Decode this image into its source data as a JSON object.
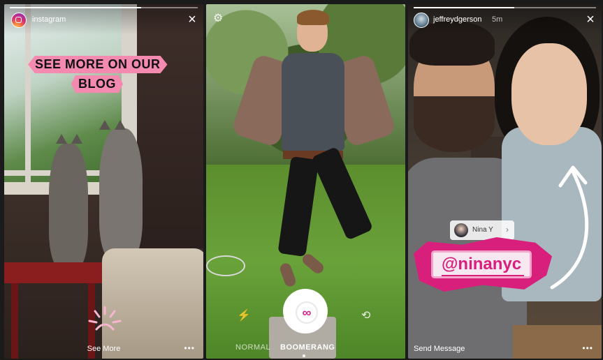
{
  "stories": [
    {
      "username": "instagram",
      "banner_line1": "SEE MORE ON OUR",
      "banner_line2": "BLOG",
      "cta": "See More",
      "more": "•••",
      "close": "×"
    },
    {
      "modes": [
        "NORMAL",
        "BOOMERANG"
      ],
      "active_mode": "BOOMERANG",
      "shutter_glyph": "∞",
      "flash_glyph": "⚡",
      "flip_glyph": "⟲",
      "settings_glyph": "⚙"
    },
    {
      "username": "jeffreydgerson",
      "time": "5m",
      "mention_chip_name": "Nina Y",
      "mention_chip_chevron": "›",
      "mention_tag": "@ninanyc",
      "send_message": "Send Message",
      "more": "•••",
      "close": "×"
    }
  ],
  "colors": {
    "mention_pink": "#d81f7c",
    "banner_pink": "#f58ab0"
  }
}
